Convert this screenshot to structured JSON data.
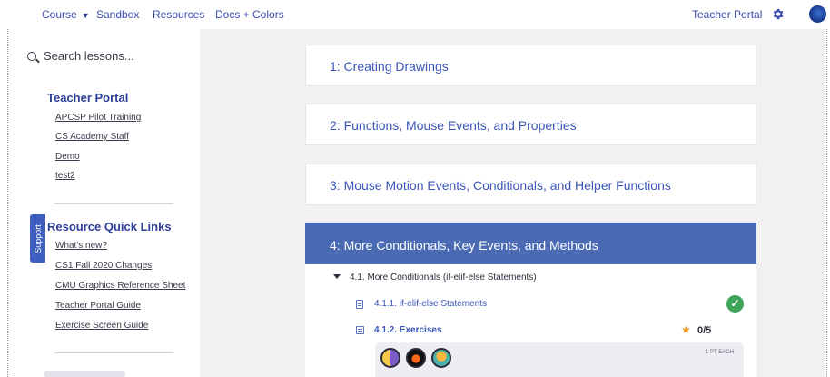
{
  "nav": {
    "course": "Course",
    "sandbox": "Sandbox",
    "resources": "Resources",
    "docs": "Docs + Colors",
    "teacher_portal": "Teacher Portal"
  },
  "sidebar": {
    "search_placeholder": "Search lessons...",
    "teacher_portal_heading": "Teacher Portal",
    "teacher_links": [
      "APCSP Pilot Training",
      "CS Academy Staff",
      "Demo",
      "test2"
    ],
    "quick_links_heading": "Resource Quick Links",
    "quick_links": [
      "What's new?",
      "CS1 Fall 2020 Changes",
      "CMU Graphics Reference Sheet",
      "Teacher Portal Guide",
      "Exercise Screen Guide"
    ],
    "support_label": "Support"
  },
  "units": [
    {
      "title": "1: Creating Drawings"
    },
    {
      "title": "2: Functions, Mouse Events, and Properties"
    },
    {
      "title": "3: Mouse Motion Events, Conditionals, and Helper Functions"
    },
    {
      "title": "4: More Conditionals, Key Events, and Methods"
    }
  ],
  "unit4": {
    "section_title": "4.1. More Conditionals (if-elif-else Statements)",
    "lessons": [
      {
        "label": "4.1.1. if-elif-else Statements"
      },
      {
        "label": "4.1.2. Exercises",
        "score": "0/5"
      }
    ],
    "points_label": "1 PT EACH"
  },
  "icons": {
    "gear": "gear-icon",
    "search": "search-icon",
    "check": "check-circle-icon",
    "star": "star-icon"
  },
  "colors": {
    "accent": "#3b55b8",
    "active_unit": "#4a6ab4",
    "success": "#3fa55a",
    "star": "#f29a1c",
    "support": "#3f5fc0"
  }
}
